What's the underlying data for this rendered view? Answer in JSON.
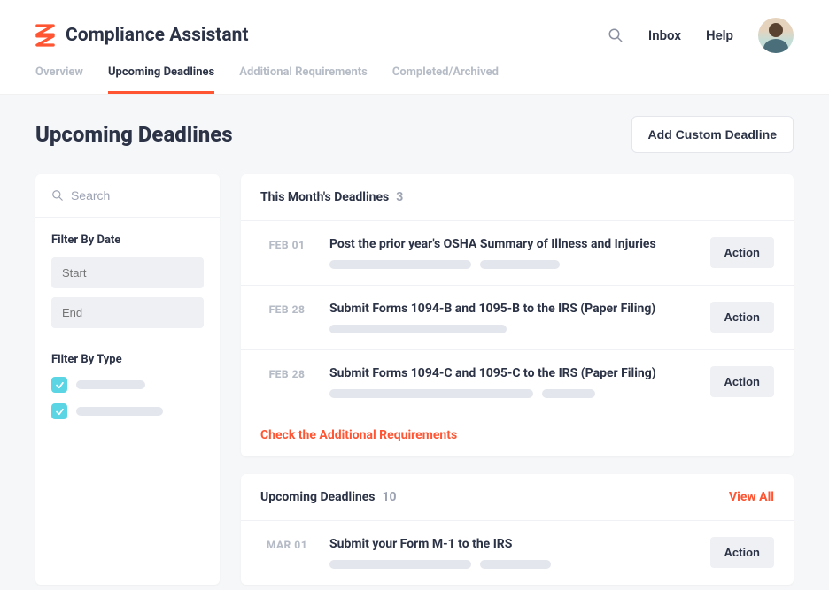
{
  "header": {
    "app_title": "Compliance Assistant",
    "inbox": "Inbox",
    "help": "Help"
  },
  "tabs": [
    {
      "label": "Overview",
      "active": false
    },
    {
      "label": "Upcoming Deadlines",
      "active": true
    },
    {
      "label": "Additional Requirements",
      "active": false
    },
    {
      "label": "Completed/Archived",
      "active": false
    }
  ],
  "page": {
    "title": "Upcoming Deadlines",
    "add_button": "Add Custom Deadline"
  },
  "filters": {
    "search_placeholder": "Search",
    "by_date_label": "Filter By Date",
    "start_placeholder": "Start",
    "end_placeholder": "End",
    "by_type_label": "Filter By Type"
  },
  "sections": {
    "this_month": {
      "title": "This Month's Deadlines",
      "count": "3",
      "items": [
        {
          "date": "FEB 01",
          "title": "Post the prior year's OSHA Summary of Illness and Injuries",
          "action": "Action"
        },
        {
          "date": "FEB 28",
          "title": "Submit Forms 1094-B and 1095-B to the IRS (Paper Filing)",
          "action": "Action"
        },
        {
          "date": "FEB 28",
          "title": "Submit Forms 1094-C and 1095-C to the IRS (Paper Filing)",
          "action": "Action"
        }
      ],
      "check_link": "Check the Additional Requirements"
    },
    "upcoming": {
      "title": "Upcoming Deadlines",
      "count": "10",
      "view_all": "View All",
      "items": [
        {
          "date": "MAR 01",
          "title": "Submit your Form M-1 to the IRS",
          "action": "Action"
        }
      ]
    }
  }
}
